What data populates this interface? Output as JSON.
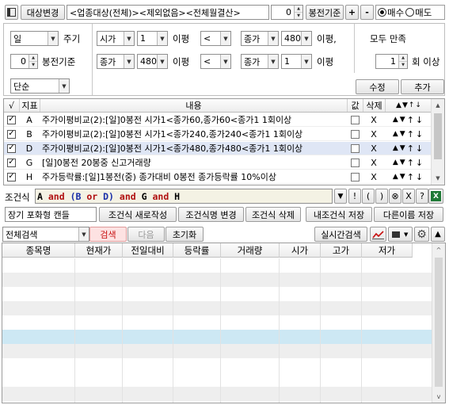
{
  "toolbar": {
    "target_change": "대상변경",
    "target_value": "<업종대상(전체)><제외없음><전체월결산>",
    "shift_value": "0",
    "base_label": "봉전기준",
    "plus": "+",
    "minus": "-",
    "radio_buy": "매수",
    "radio_sell": "매도",
    "buy_selected": true
  },
  "settings": {
    "period_value": "일",
    "period_label": "주기",
    "base_value": "0",
    "base_label": "봉전기준",
    "mode_value": "단순",
    "cond1": {
      "field1": "시가",
      "num1": "1",
      "lbl1": "이평",
      "op": "<",
      "field2": "종가",
      "num2": "480",
      "lbl2": "이평,"
    },
    "cond2": {
      "field1": "종가",
      "num1": "480",
      "lbl1": "이평",
      "op": "<",
      "field2": "종가",
      "num2": "1",
      "lbl2": "이평"
    },
    "all_satisfy": "모두 만족",
    "count_value": "1",
    "count_label": "회 이상",
    "modify_button": "수정",
    "add_button": "추가"
  },
  "list": {
    "headers": {
      "check": "√",
      "indicator": "지표",
      "content": "내용",
      "value": "값",
      "delete": "삭제"
    },
    "rows": [
      {
        "checked": true,
        "id": "A",
        "content": "주가이평비교(2):[일]0봉전 시가1<종가60,종가60<종가1 1회이상",
        "delete": "X",
        "selected": false
      },
      {
        "checked": true,
        "id": "B",
        "content": "주가이평비교(2):[일]0봉전 시가1<종가240,종가240<종가1 1회이상",
        "delete": "X",
        "selected": false
      },
      {
        "checked": true,
        "id": "D",
        "content": "주가이평비교(2):[일]0봉전 시가1<종가480,종가480<종가1 1회이상",
        "delete": "X",
        "selected": true
      },
      {
        "checked": true,
        "id": "G",
        "content": "[일]0봉전 20봉중 신고거래량",
        "delete": "X",
        "selected": false
      },
      {
        "checked": true,
        "id": "H",
        "content": "주가등락률:[일]1봉전(중) 종가대비 0봉전 종가등락률 10%이상",
        "delete": "X",
        "selected": false
      }
    ]
  },
  "formula": {
    "label": "조건식",
    "tokens": [
      {
        "t": "A",
        "c": "#000000"
      },
      {
        "t": " and ",
        "c": "#b01010"
      },
      {
        "t": "(B",
        "c": "#1a2fa8"
      },
      {
        "t": " or ",
        "c": "#b01010"
      },
      {
        "t": "D)",
        "c": "#1a2fa8"
      },
      {
        "t": " and ",
        "c": "#b01010"
      },
      {
        "t": "G",
        "c": "#000000"
      },
      {
        "t": " and ",
        "c": "#b01010"
      },
      {
        "t": "H",
        "c": "#000000"
      }
    ],
    "ops": [
      "!",
      "(",
      ")",
      "⊗",
      "X",
      "?"
    ]
  },
  "actions": {
    "input_value": "장기 포화형 캔들",
    "new_condition": "조건식 새로작성",
    "change_condition": "조건식명 변경",
    "delete_condition": "조건식 삭제",
    "save_mine": "내조건식 저장",
    "save_as": "다른이름 저장"
  },
  "search": {
    "scope_value": "전체검색",
    "search_button": "검색",
    "next_button": "다음",
    "reset_button": "초기화",
    "realtime_button": "실시간검색"
  },
  "grid": {
    "columns": [
      "종목명",
      "현재가",
      "전일대비",
      "등락률",
      "거래량",
      "시가",
      "고가",
      "저가"
    ]
  },
  "colors": {
    "selected_row": "#dfe6f5",
    "highlight_row": "#cde8f4",
    "alt_row": "#eeeeee",
    "search_btn_bg": "#fde2e2",
    "excel_green": "#1f7a36"
  }
}
